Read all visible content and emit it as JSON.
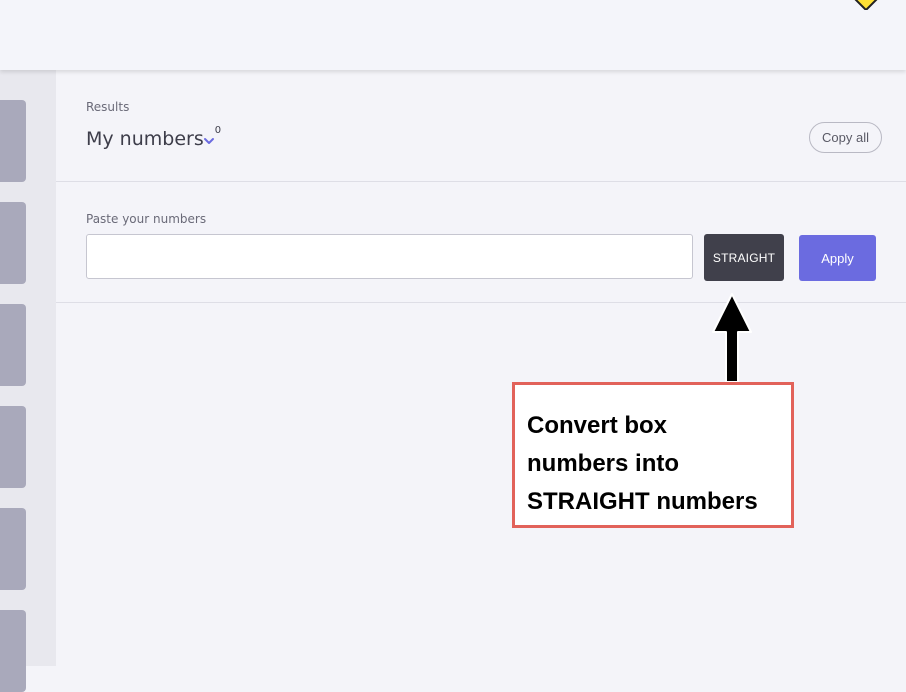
{
  "results": {
    "label": "Results",
    "title": "My numbers",
    "count": "0",
    "copy_all_label": "Copy all"
  },
  "paste": {
    "label": "Paste your numbers",
    "input_value": "",
    "straight_label": "STRAIGHT",
    "apply_label": "Apply"
  },
  "annotation": {
    "lines": [
      "Convert box",
      "numbers into",
      "STRAIGHT numbers"
    ]
  },
  "icons": {
    "top_right": "diamond-icon",
    "title_dropdown": "chevron-down-icon",
    "annotation_arrow": "arrow-up-icon"
  },
  "colors": {
    "accent": "#6b6be0",
    "straight_button": "#40404b",
    "sidebar_tab": "#a9a9bb",
    "callout_border": "#e2625a",
    "diamond": "#ffe135"
  }
}
